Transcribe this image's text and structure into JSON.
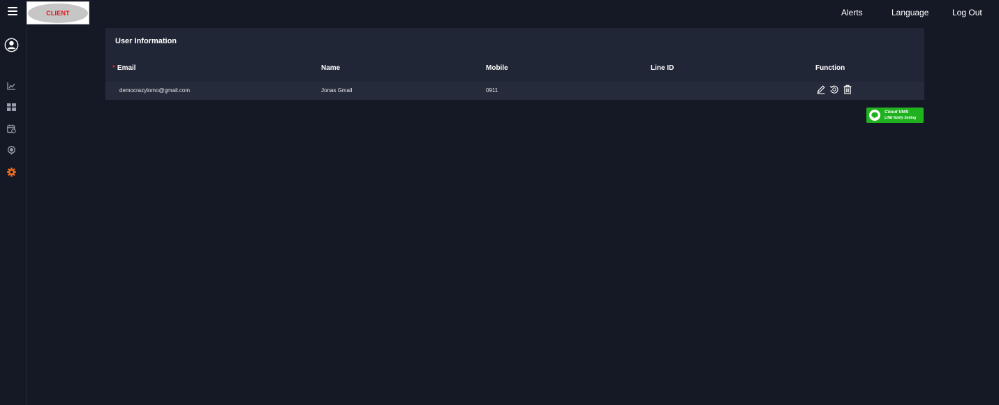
{
  "header": {
    "logo_text": "CLIENT",
    "links": {
      "alerts": "Alerts",
      "language": "Language",
      "logout": "Log Out"
    }
  },
  "sidebar": {
    "items": [
      {
        "icon": "user-profile-icon"
      },
      {
        "icon": "line-chart-icon"
      },
      {
        "icon": "grid-dashboard-icon"
      },
      {
        "icon": "calendar-camera-icon"
      },
      {
        "icon": "map-pin-icon"
      },
      {
        "icon": "gear-icon",
        "active": true
      }
    ],
    "active_color": "#f26d21"
  },
  "panel": {
    "title": "User Information",
    "columns": {
      "required_mark": "*",
      "email": "Email",
      "name": "Name",
      "mobile": "Mobile",
      "line_id": "Line ID",
      "function": "Function"
    },
    "rows": [
      {
        "email": "democrazylomo@gmail.com",
        "name": "Jonas Gmail",
        "mobile": "0911",
        "line_id": "",
        "functions": [
          "edit-icon",
          "reset-icon",
          "trash-icon"
        ]
      }
    ]
  },
  "line_notify": {
    "title": "Cloud VMS",
    "subtitle": "LINE Notify Setting",
    "color": "#1fb21f"
  }
}
